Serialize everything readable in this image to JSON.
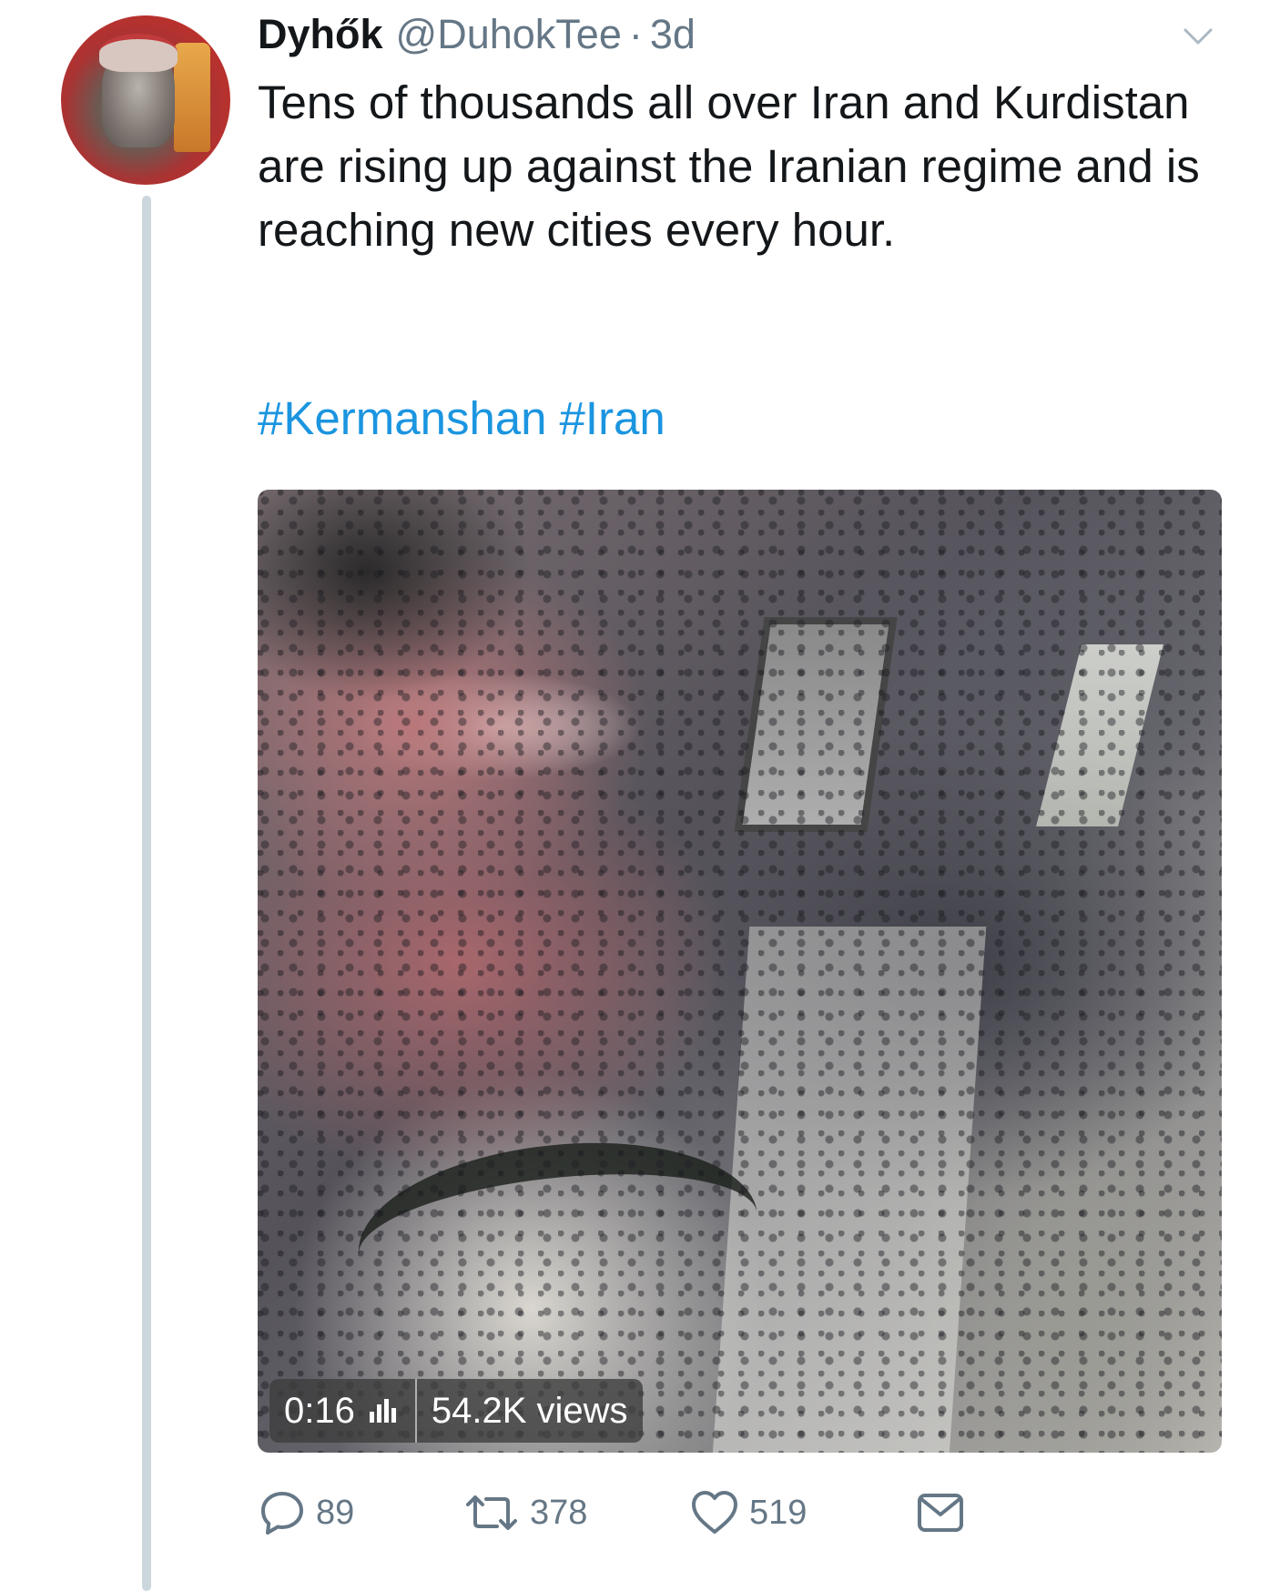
{
  "tweet": {
    "display_name": "Dyhők",
    "handle": "@DuhokTee",
    "separator": "·",
    "time": "3d",
    "text": "Tens of thousands all over Iran and Kurdistan are rising up against the Iranian regime and is reaching new cities every hour.",
    "hashtags": [
      "#Kermanshan",
      "#Iran"
    ]
  },
  "media": {
    "duration": "0:16",
    "views": "54.2K views"
  },
  "actions": {
    "replies": "89",
    "retweets": "378",
    "likes": "519"
  },
  "icons": {
    "more": "chevron-down-icon",
    "reply": "reply-icon",
    "retweet": "retweet-icon",
    "like": "heart-icon",
    "dm": "envelope-icon",
    "stats": "stats-bars-icon"
  },
  "colors": {
    "link": "#1b95e0",
    "secondary_text": "#657786",
    "thread_line": "#ccd6dd"
  }
}
